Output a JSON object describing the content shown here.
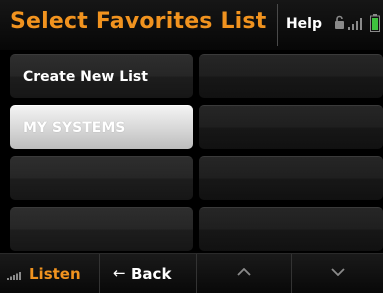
{
  "header": {
    "title": "Select Favorites List",
    "help_label": "Help",
    "icons": [
      "lock-icon",
      "signal-strength-icon",
      "battery-icon"
    ]
  },
  "lists": {
    "items": [
      {
        "label": "Create New List",
        "selected": false
      },
      {
        "label": "",
        "selected": false
      },
      {
        "label": "MY SYSTEMS",
        "selected": true
      },
      {
        "label": "",
        "selected": false
      },
      {
        "label": "",
        "selected": false
      },
      {
        "label": "",
        "selected": false
      },
      {
        "label": "",
        "selected": false
      },
      {
        "label": "",
        "selected": false
      }
    ]
  },
  "footer": {
    "listen_label": "Listen",
    "back_arrow": "←",
    "back_label": "Back",
    "up_icon": "chevron-up-icon",
    "down_icon": "chevron-down-icon"
  },
  "colors": {
    "accent": "#f1931f",
    "battery": "#3ec13e",
    "background": "#000000"
  }
}
